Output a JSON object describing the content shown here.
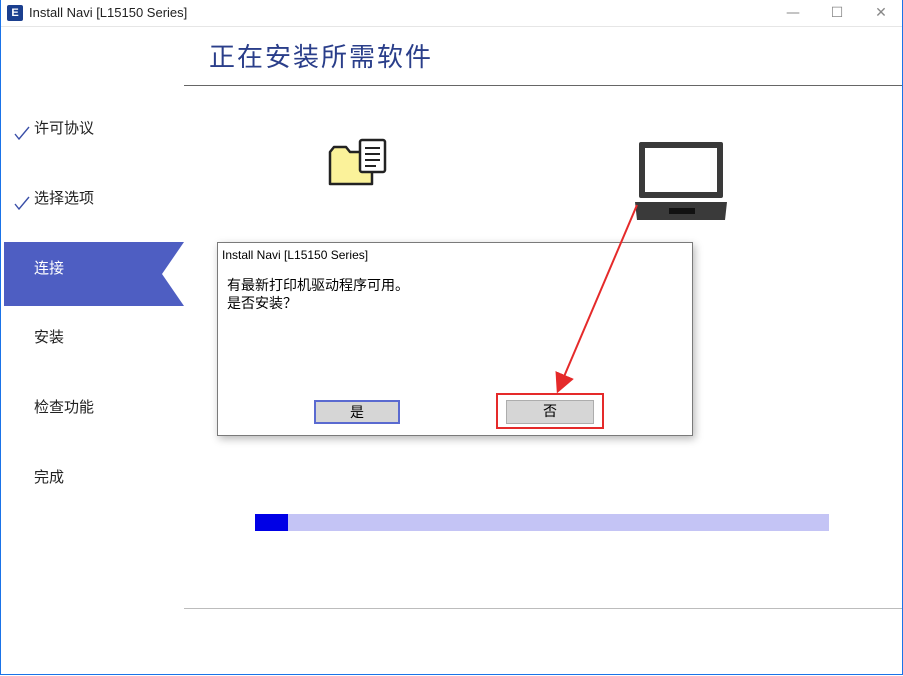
{
  "window": {
    "title": "Install Navi [L15150 Series]",
    "app_icon_letter": "E",
    "minimize_glyph": "—",
    "maximize_glyph": "☐",
    "close_glyph": "✕"
  },
  "page_title": "正在安装所需软件",
  "steps": [
    {
      "label": "许可协议",
      "state": "done"
    },
    {
      "label": "选择选项",
      "state": "done"
    },
    {
      "label": "连接",
      "state": "active"
    },
    {
      "label": "安装",
      "state": "pending"
    },
    {
      "label": "检查功能",
      "state": "pending"
    },
    {
      "label": "完成",
      "state": "pending"
    }
  ],
  "icons": {
    "folder": "folder-document-icon",
    "laptop": "laptop-icon",
    "check": "checkmark-icon"
  },
  "progress": {
    "fraction": 0.057,
    "fill_color": "#0000e6",
    "track_color": "#c4c4f5"
  },
  "dialog": {
    "title": "Install Navi [L15150 Series]",
    "message_line1": "有最新打印机驱动程序可用。",
    "message_line2": "是否安装？",
    "yes_label": "是",
    "no_label": "否"
  },
  "colors": {
    "accent": "#4e5ec2",
    "title_text": "#2a3e8a",
    "annotation": "#e52a2a"
  }
}
